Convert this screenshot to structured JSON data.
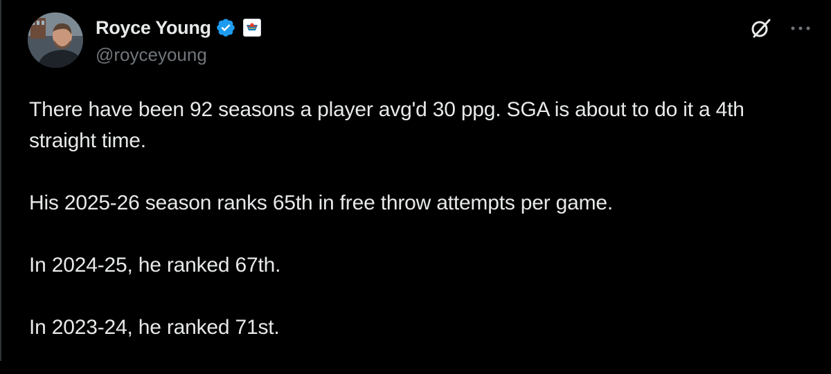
{
  "author": {
    "display_name": "Royce Young",
    "handle": "@royceyoung",
    "verified": true,
    "affiliate_badge": "okc-thunder-logo"
  },
  "actions": {
    "grok_icon": "grok-icon",
    "more_icon": "more-icon"
  },
  "tweet": {
    "paragraphs": [
      "There have been 92 seasons a player avg'd 30 ppg. SGA is about to do it a 4th straight time.",
      "His 2025-26 season ranks 65th in free throw attempts per game.",
      "In 2024-25, he ranked 67th.",
      "In 2023-24, he ranked 71st."
    ]
  },
  "colors": {
    "background": "#000000",
    "text": "#e7e9ea",
    "secondary_text": "#71767b",
    "verified_blue": "#1d9bf0",
    "border": "#2f3336"
  }
}
